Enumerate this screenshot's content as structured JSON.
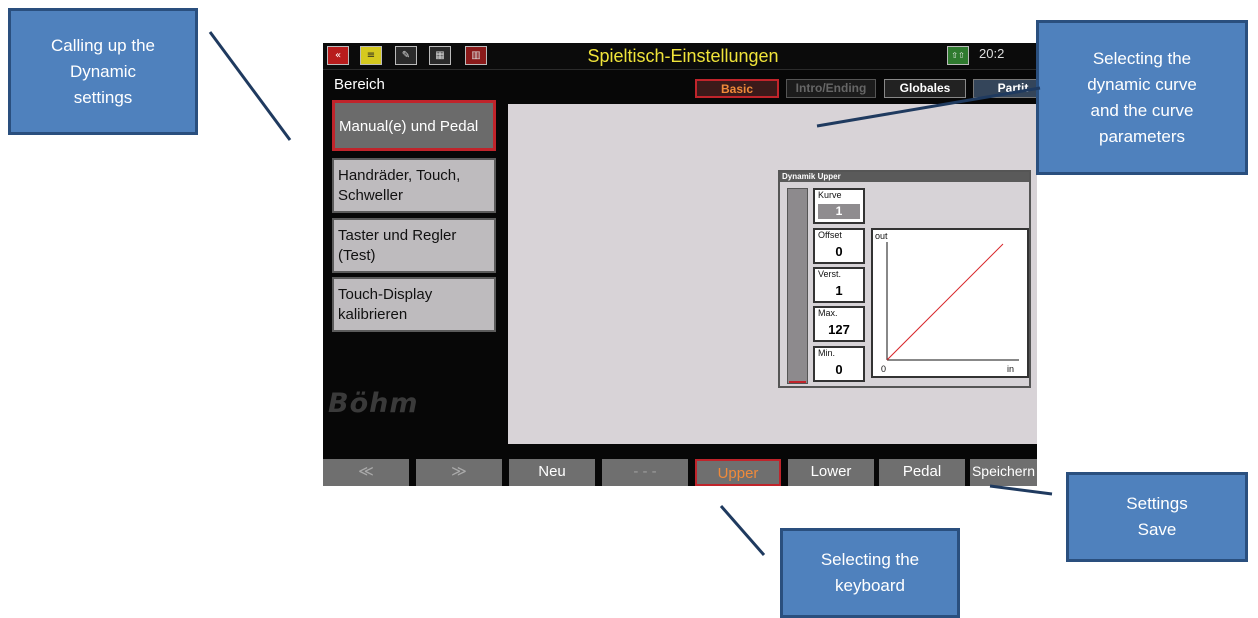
{
  "callouts": {
    "dynamic": [
      "Calling up the",
      "Dynamic",
      "settings"
    ],
    "curve": [
      "Selecting the",
      "dynamic curve",
      "and the curve",
      "parameters"
    ],
    "save": [
      "Settings",
      "Save"
    ],
    "keyboard": [
      "Selecting the",
      "keyboard"
    ]
  },
  "colors": {
    "callout_fill": "#4f81bd",
    "title_yellow": "#f0e43a",
    "active_red": "#c0242b",
    "panel_grey": "#d8d3d7"
  },
  "screen": {
    "title": "Spieltisch-Einstellungen",
    "clock": "20:2",
    "toolbar_icons": [
      {
        "name": "back",
        "glyph": "«"
      },
      {
        "name": "menu",
        "glyph": "≡"
      },
      {
        "name": "edit",
        "glyph": "✎"
      },
      {
        "name": "grid",
        "glyph": "▦"
      },
      {
        "name": "delete",
        "glyph": "▥"
      }
    ],
    "status_icon": "shift",
    "area_label": "Bereich",
    "tabs": [
      "Basic",
      "Intro/Ending",
      "Globales",
      "Partit"
    ],
    "side_buttons": [
      "Manual(e) und Pedal",
      "Handräder, Touch, Schweller",
      "Taster und Regler (Test)",
      "Touch-Display kalibrieren"
    ],
    "logo": "Böhm",
    "dynamics": {
      "title": "Dynamik  Upper",
      "curve_label": "Kurve",
      "curve_value": "1",
      "params": [
        {
          "label": "Offset",
          "value": "0"
        },
        {
          "label": "Verst.",
          "value": "1"
        },
        {
          "label": "Max.",
          "value": "127"
        },
        {
          "label": "Min.",
          "value": "0"
        }
      ],
      "graph": {
        "y_label": "out",
        "x_label": "in",
        "origin_label": "0"
      }
    },
    "softkeys": [
      "≪",
      "≫",
      "Neu",
      "- - -",
      "Upper",
      "Lower",
      "Pedal",
      "Speichern"
    ]
  }
}
